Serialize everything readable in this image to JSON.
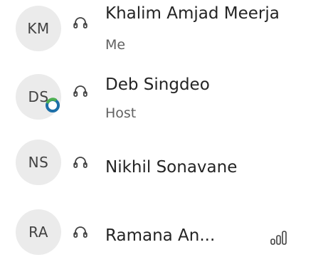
{
  "participants": [
    {
      "initials": "KM",
      "name": "Khalim Amjad Meerja",
      "role": "Me",
      "icon": "headset-icon"
    },
    {
      "initials": "DS",
      "name": "Deb Singdeo",
      "role": "Host",
      "icon": "headset-icon",
      "badge": "status-ring-icon"
    },
    {
      "initials": "NS",
      "name": "Nikhil Sonavane",
      "role": "",
      "icon": "headset-icon"
    },
    {
      "initials": "RA",
      "name": "Ramana An...",
      "role": "",
      "icon": "headset-icon",
      "extra_icon": "signal-bars-icon"
    }
  ],
  "colors": {
    "avatar_bg": "#ebebeb",
    "text_primary": "#242424",
    "text_secondary": "#616161",
    "badge_ring": "#1c6fa8",
    "badge_ring_green": "#4caf50"
  }
}
